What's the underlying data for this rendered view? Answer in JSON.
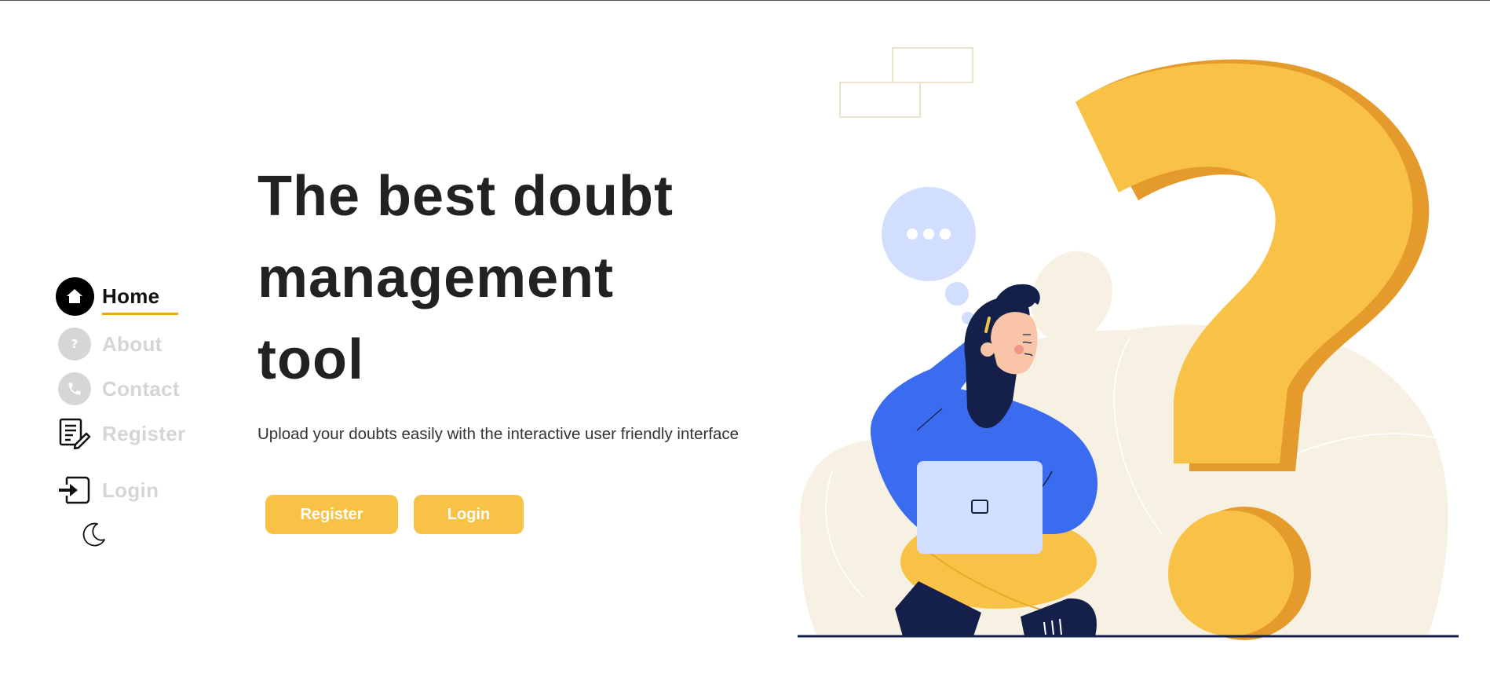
{
  "sidebar": {
    "items": [
      {
        "label": "Home",
        "icon": "home-icon",
        "active": true
      },
      {
        "label": "About",
        "icon": "question-icon",
        "active": false
      },
      {
        "label": "Contact",
        "icon": "phone-icon",
        "active": false
      },
      {
        "label": "Register",
        "icon": "register-form-icon",
        "active": false
      },
      {
        "label": "Login",
        "icon": "login-icon",
        "active": false
      }
    ],
    "theme_toggle_icon": "moon-icon"
  },
  "hero": {
    "title_line1": "The best doubt",
    "title_line2": "management",
    "title_line3": "tool",
    "subtitle": "Upload your doubts easily with the interactive user friendly interface",
    "register_label": "Register",
    "login_label": "Login"
  },
  "colors": {
    "accent": "#f8c246",
    "accent_underline": "#f0a417",
    "text": "#222222",
    "muted": "#d5d5d5",
    "illustration_blue": "#3b6cf0",
    "illustration_yellow": "#f8c246",
    "illustration_cream": "#f6f1e3"
  }
}
